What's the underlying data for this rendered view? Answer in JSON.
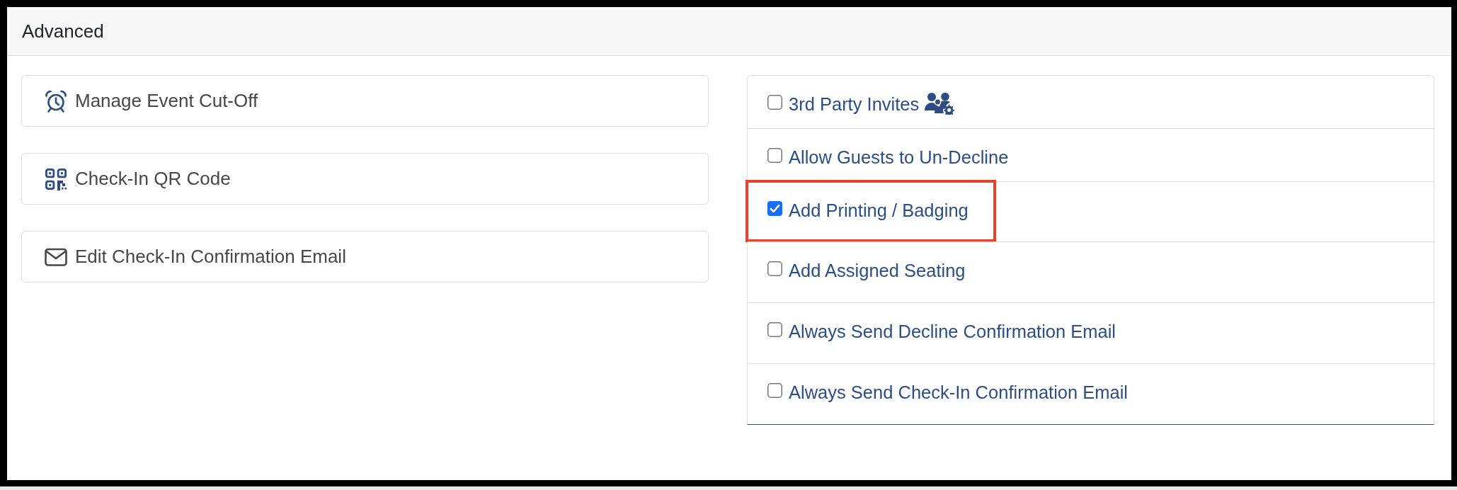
{
  "panel": {
    "title": "Advanced"
  },
  "actions": [
    {
      "label": "Manage Event Cut-Off",
      "kind": "deadline"
    },
    {
      "label": "Check-In QR Code",
      "kind": "qr"
    },
    {
      "label": "Edit Check-In Confirmation Email",
      "kind": "email"
    }
  ],
  "options": [
    {
      "label": "3rd Party Invites",
      "kind": "with-icon",
      "checked": false,
      "highlighted": false
    },
    {
      "label": "Allow Guests to Un-Decline",
      "kind": "plain",
      "checked": false,
      "highlighted": false
    },
    {
      "label": "Add Printing / Badging",
      "kind": "plain",
      "checked": true,
      "highlighted": true
    },
    {
      "label": "Add Assigned Seating",
      "kind": "plain",
      "checked": false,
      "highlighted": false
    },
    {
      "label": "Always Send Decline Confirmation Email",
      "kind": "plain",
      "checked": false,
      "highlighted": false
    },
    {
      "label": "Always Send Check-In Confirmation Email",
      "kind": "plain",
      "checked": false,
      "highlighted": false
    }
  ]
}
